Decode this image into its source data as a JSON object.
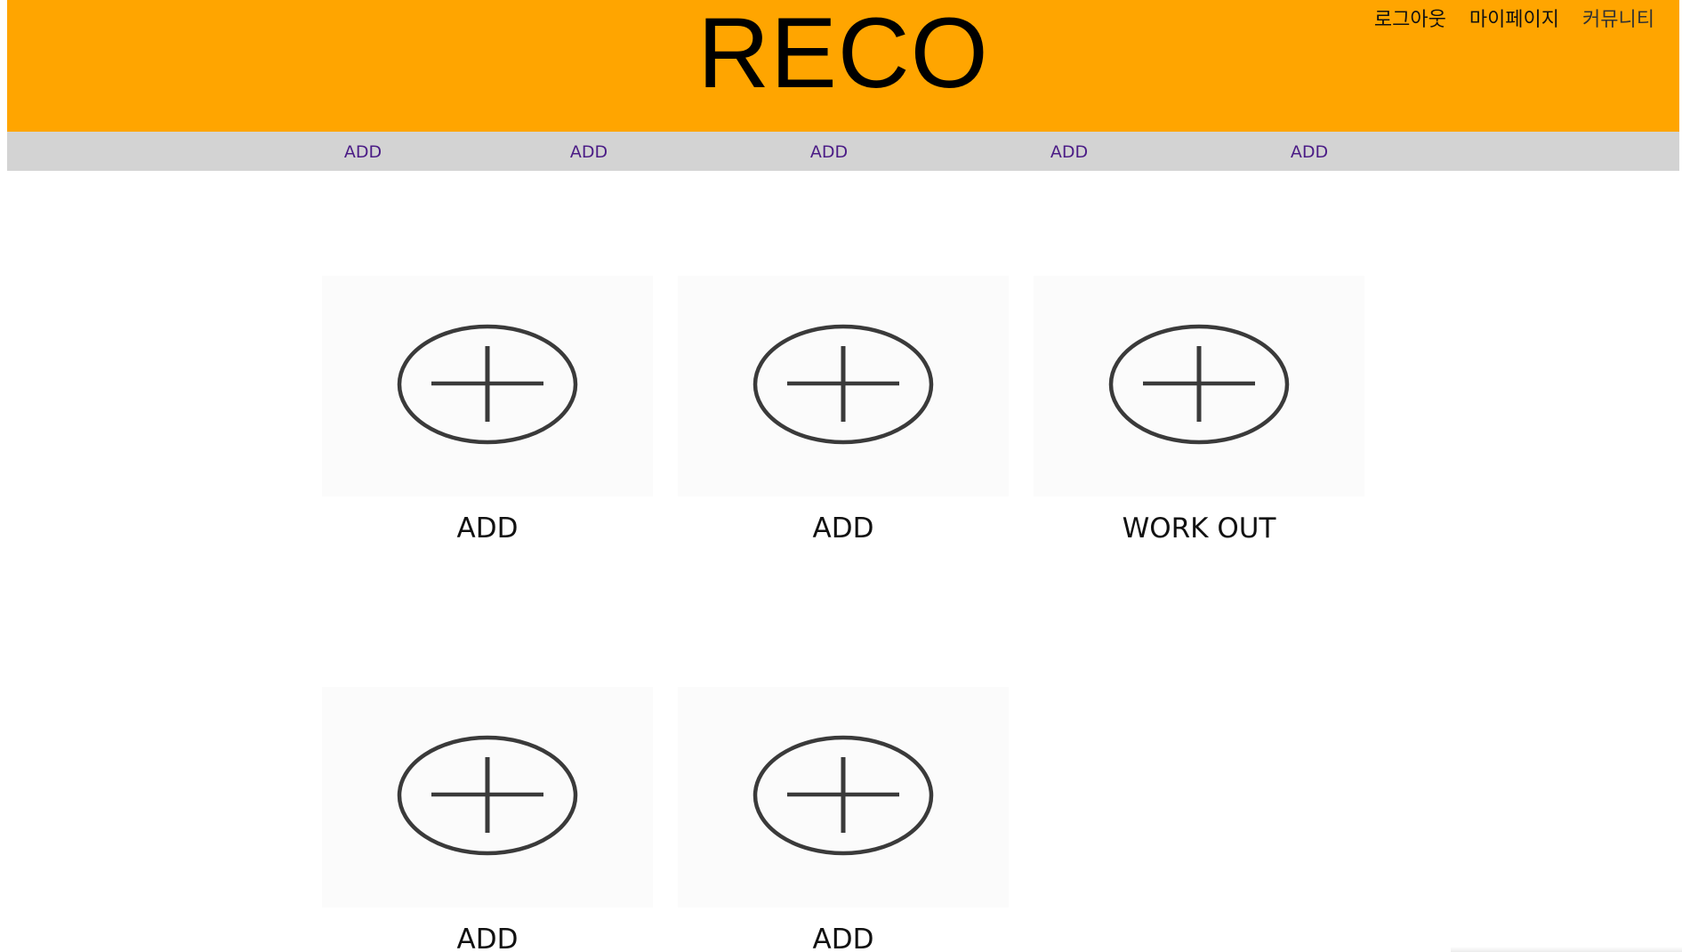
{
  "header": {
    "logo": "RECO",
    "user_menu": [
      "로그아웃",
      "마이페이지",
      "커뮤니티"
    ],
    "background": "#FFA500"
  },
  "nav": {
    "items": [
      "ADD",
      "ADD",
      "ADD",
      "ADD",
      "ADD"
    ],
    "background": "#D3D3D3",
    "link_color": "#4B1C86"
  },
  "cards": [
    {
      "label": "ADD",
      "icon": "plus-circle-icon"
    },
    {
      "label": "ADD",
      "icon": "plus-circle-icon"
    },
    {
      "label": "WORK OUT",
      "icon": "plus-circle-icon"
    },
    {
      "label": "ADD",
      "icon": "plus-circle-icon"
    },
    {
      "label": "ADD",
      "icon": "plus-circle-icon"
    }
  ]
}
